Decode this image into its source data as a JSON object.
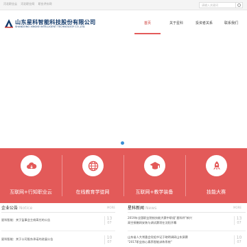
{
  "topbar": {
    "links": [
      "河北职业云",
      "河北职业网",
      "职业评价网"
    ],
    "search_placeholder": "请输入关键词"
  },
  "logo": {
    "name_cn": "山东星科智能科技股份有限公司",
    "name_en": "SHANDONG XINGKE INTELLIGENT TECHNOLOGY CO.,LTD."
  },
  "nav": {
    "items": [
      "首页",
      "关于星科",
      "投资者关系",
      "联系我们"
    ],
    "active_index": 0
  },
  "banner": {
    "active_slide": 1
  },
  "features": [
    {
      "label": "互联网+行知职业云",
      "icon": "cloud-icon"
    },
    {
      "label": "在线教育学徒网",
      "icon": "globe-icon"
    },
    {
      "label": "互联网+教学装备",
      "icon": "graduation-cap-icon"
    },
    {
      "label": "技能大赛",
      "icon": "rocket-icon"
    }
  ],
  "notice": {
    "title": "企业公告",
    "subtitle": "Notice",
    "more": "MORE",
    "items": [
      {
        "text": "星科智能：关于监事会主席离任的公告",
        "day": "13",
        "month": "07"
      },
      {
        "text": "星科智能：关于公司股东承诺的进展公告",
        "day": "10",
        "month": "07"
      }
    ]
  },
  "news": {
    "title": "星科新闻",
    "subtitle": "News",
    "more": "MORE",
    "items": [
      {
        "text": "2019年全国职业院校技能大赛中职组\"星科杯\"新兴",
        "text2": "高空接触网安装与调试赛项在沈阳开幕",
        "day": "13",
        "month": "07"
      },
      {
        "text": "山东省人大常委会党组书记于晓明调研山东屏赛",
        "text2": "\"2017职业核心素养智能训练系统\"",
        "day": "10",
        "month": "07"
      }
    ]
  },
  "colors": {
    "accent": "#e35a59",
    "nav_active": "#c9302c",
    "logo_blue": "#123a6b",
    "dot": "#3b8fd6"
  }
}
